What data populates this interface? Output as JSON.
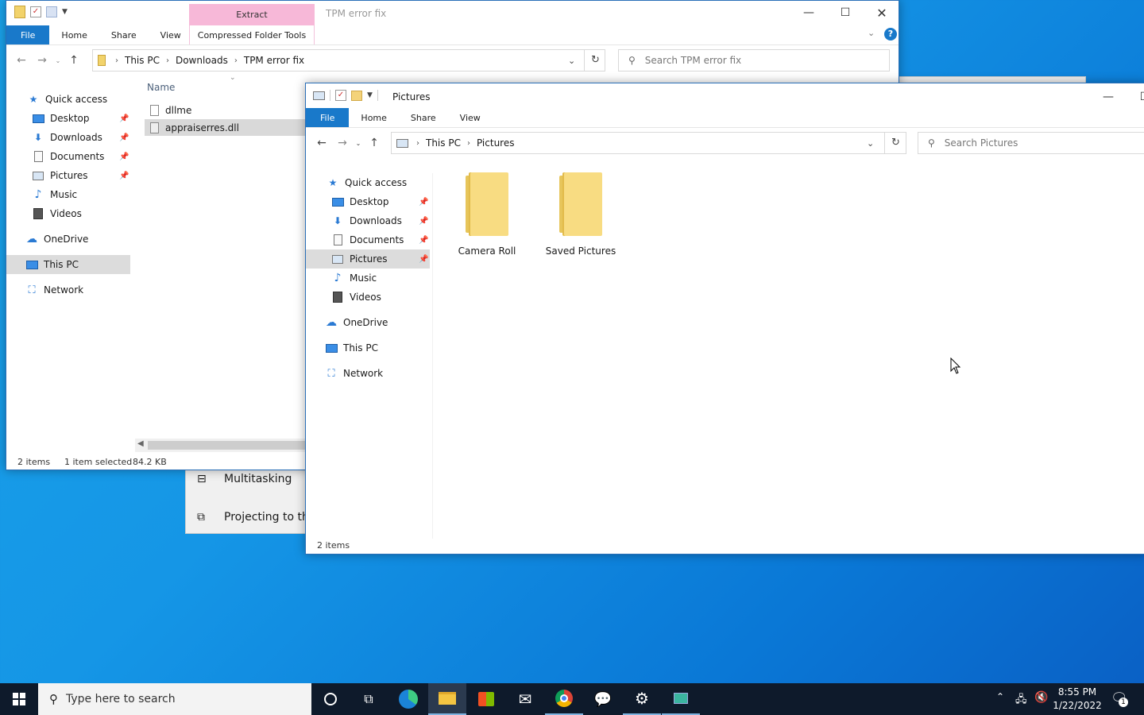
{
  "settings_bg": {
    "items": [
      {
        "icon": "multitasking-icon",
        "label": "Multitasking"
      },
      {
        "icon": "projecting-icon",
        "label": "Projecting to this"
      }
    ]
  },
  "win1": {
    "title": "TPM error fix",
    "context_header": "Extract",
    "context_tab": "Compressed Folder Tools",
    "tabs": {
      "file": "File",
      "home": "Home",
      "share": "Share",
      "view": "View"
    },
    "breadcrumb": [
      "This PC",
      "Downloads",
      "TPM error fix"
    ],
    "search_placeholder": "Search TPM error fix",
    "column_name": "Name",
    "files": [
      {
        "name": "dllme",
        "icon": "text-file-icon"
      },
      {
        "name": "appraiserres.dll",
        "icon": "dll-file-icon"
      }
    ],
    "nav": {
      "quick_access": "Quick access",
      "desktop": "Desktop",
      "downloads": "Downloads",
      "documents": "Documents",
      "pictures": "Pictures",
      "music": "Music",
      "videos": "Videos",
      "onedrive": "OneDrive",
      "this_pc": "This PC",
      "network": "Network"
    },
    "status": {
      "count": "2 items",
      "selected": "1 item selected",
      "size": "84.2 KB"
    }
  },
  "win2": {
    "title": "Pictures",
    "tabs": {
      "file": "File",
      "home": "Home",
      "share": "Share",
      "view": "View"
    },
    "breadcrumb": [
      "This PC",
      "Pictures"
    ],
    "search_placeholder": "Search Pictures",
    "nav": {
      "quick_access": "Quick access",
      "desktop": "Desktop",
      "downloads": "Downloads",
      "documents": "Documents",
      "pictures": "Pictures",
      "music": "Music",
      "videos": "Videos",
      "onedrive": "OneDrive",
      "this_pc": "This PC",
      "network": "Network"
    },
    "folders": [
      "Camera Roll",
      "Saved Pictures"
    ],
    "status": {
      "count": "2 items"
    }
  },
  "taskbar": {
    "search_placeholder": "Type here to search",
    "time": "8:55 PM",
    "date": "1/22/2022",
    "notification_count": "1"
  },
  "colors": {
    "accent": "#1979ca",
    "context_tab": "#f7b8d8",
    "taskbar": "#0e1a2b"
  }
}
